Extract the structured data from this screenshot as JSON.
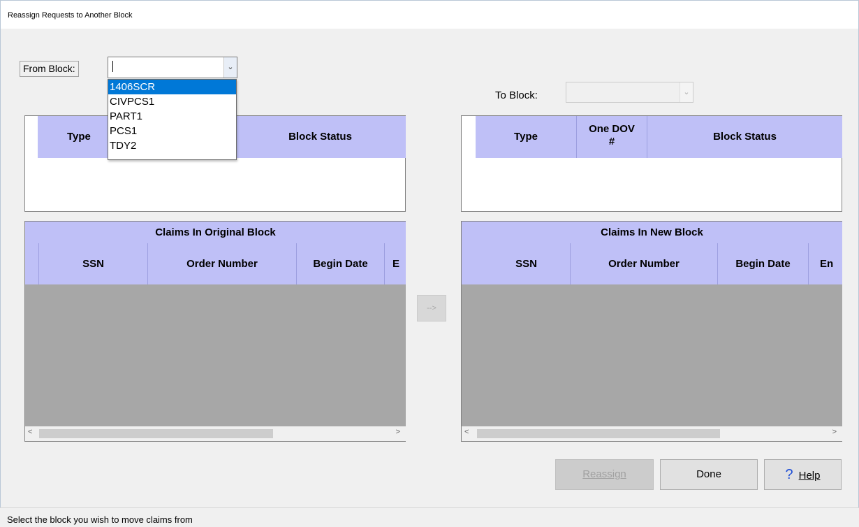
{
  "window": {
    "title": "Reassign Requests to Another Block"
  },
  "from_block": {
    "label": "From Block:",
    "value": "",
    "options": [
      "1406SCR",
      "CIVPCS1",
      "PART1",
      "PCS1",
      "TDY2"
    ],
    "selected_index": 0
  },
  "to_block": {
    "label": "To Block:",
    "value": ""
  },
  "left_block_grid": {
    "columns": [
      "Type",
      "Block Status"
    ]
  },
  "right_block_grid": {
    "columns": [
      "Type",
      "One DOV #",
      "Block Status"
    ]
  },
  "left_claims_grid": {
    "caption": "Claims In Original Block",
    "columns": [
      "SSN",
      "Order Number",
      "Begin Date",
      "E"
    ]
  },
  "right_claims_grid": {
    "caption": "Claims In New Block",
    "columns": [
      "SSN",
      "Order Number",
      "Begin Date",
      "En"
    ]
  },
  "buttons": {
    "move": "-->",
    "reassign": "Reassign",
    "done": "Done",
    "help": "Help",
    "help_icon": "?"
  },
  "status_bar": {
    "text": "Select the block you wish to move claims from"
  },
  "colors": {
    "header": "#bfc0f7",
    "selection": "#0078d7",
    "grid_empty": "#a7a7a7"
  }
}
